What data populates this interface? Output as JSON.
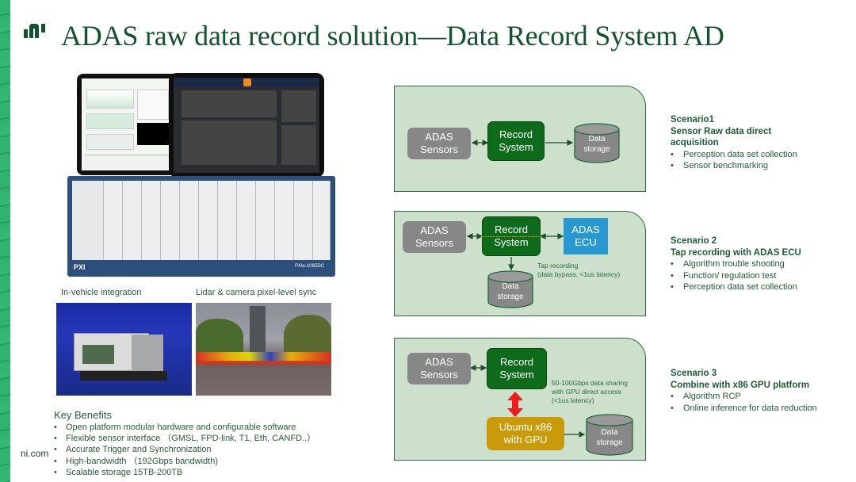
{
  "slide": {
    "title": "ADAS raw data record solution—Data Record System AD",
    "logo_icon": "ni-logo-icon",
    "footer": "ni.com"
  },
  "left": {
    "photo_labels": {
      "in_vehicle": "In-vehicle integration",
      "lidar_sync": "Lidar & camera pixel-level sync"
    },
    "hardware_model": "PXIe-1095DC",
    "hardware_brand": "PXI",
    "benefits": {
      "title": "Key Benefits",
      "items": [
        "Open platform modular hardware and configurable software",
        "Flexible sensor interface （GMSL, FPD-link, T1, Eth, CANFD..）",
        "Accurate Trigger and Synchronization",
        "High-bandwidth （192Gbps bandwidth)",
        "Scalable storage 15TB-200TB"
      ]
    }
  },
  "diagrams": {
    "colors": {
      "panel_bg": "#cde0cb",
      "panel_border": "#2f6b43",
      "sensor": "#878787",
      "record": "#0d6b1b",
      "ecu": "#2899d0",
      "gpu": "#c99a0a",
      "gpu_link": "#ee1c1c",
      "tap_line": "#d9b400"
    },
    "s1": {
      "sensor": "ADAS\nSensors",
      "record": "Record\nSystem",
      "storage": "Data\nstorage"
    },
    "s2": {
      "sensor": "ADAS\nSensors",
      "record": "Record\nSystem",
      "ecu": "ADAS\nECU",
      "storage": "Data\nstorage",
      "note_line1": "Tap recording",
      "note_line2": "(data bypass, <1us latency)"
    },
    "s3": {
      "sensor": "ADAS\nSensors",
      "record": "Record\nSystem",
      "gpu": "Ubuntu x86\nwith GPU",
      "storage": "Data\nstorage",
      "note_line1": "50-100Gbps data sharing",
      "note_line2": "with GPU direct access",
      "note_line3": "(<1us latency)"
    }
  },
  "scenarios": [
    {
      "name": "Scenario1",
      "subtitle_line1": "Sensor Raw data direct",
      "subtitle_line2": "acquisition",
      "items": [
        "Perception data set collection",
        "Sensor benchmarking"
      ]
    },
    {
      "name": "Scenario 2",
      "subtitle_line1": "Tap recording  with ADAS ECU",
      "items": [
        "Algorithm trouble shooting",
        "Function/  regulation test",
        "Perception data set collection"
      ]
    },
    {
      "name": "Scenario 3",
      "subtitle_line1": "Combine  with x86 GPU platform",
      "items": [
        "Algorithm RCP",
        "Online  inference  for data reduction"
      ]
    }
  ]
}
